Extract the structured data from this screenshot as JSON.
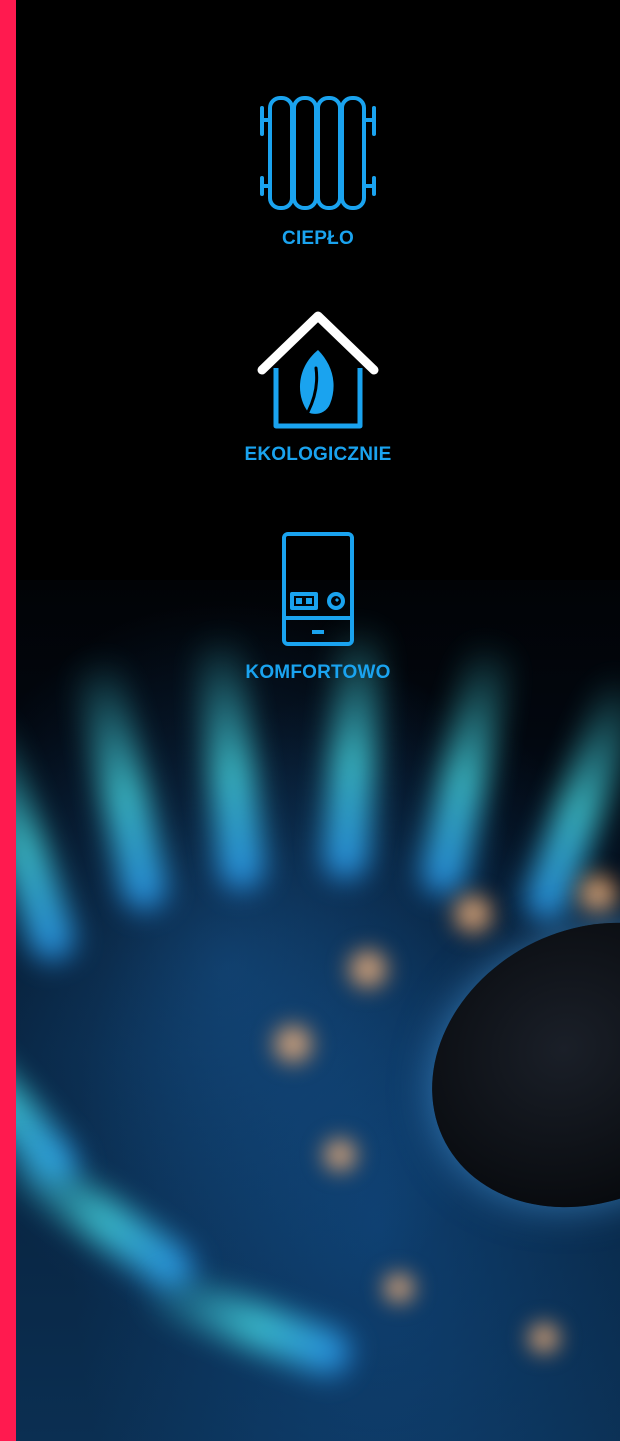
{
  "colors": {
    "accent": "#ff1a4f",
    "feature_blue": "#1aa3ef",
    "leaf_blue": "#1aa3ef",
    "roof_white": "#ffffff",
    "background": "#000000"
  },
  "features": [
    {
      "label": "CIEPŁO",
      "icon": "radiator-icon"
    },
    {
      "label": "EKOLOGICZNIE",
      "icon": "eco-house-icon"
    },
    {
      "label": "KOMFORTOWO",
      "icon": "gas-boiler-icon"
    }
  ],
  "background_image": {
    "subject": "gas-burner-flame-image"
  }
}
